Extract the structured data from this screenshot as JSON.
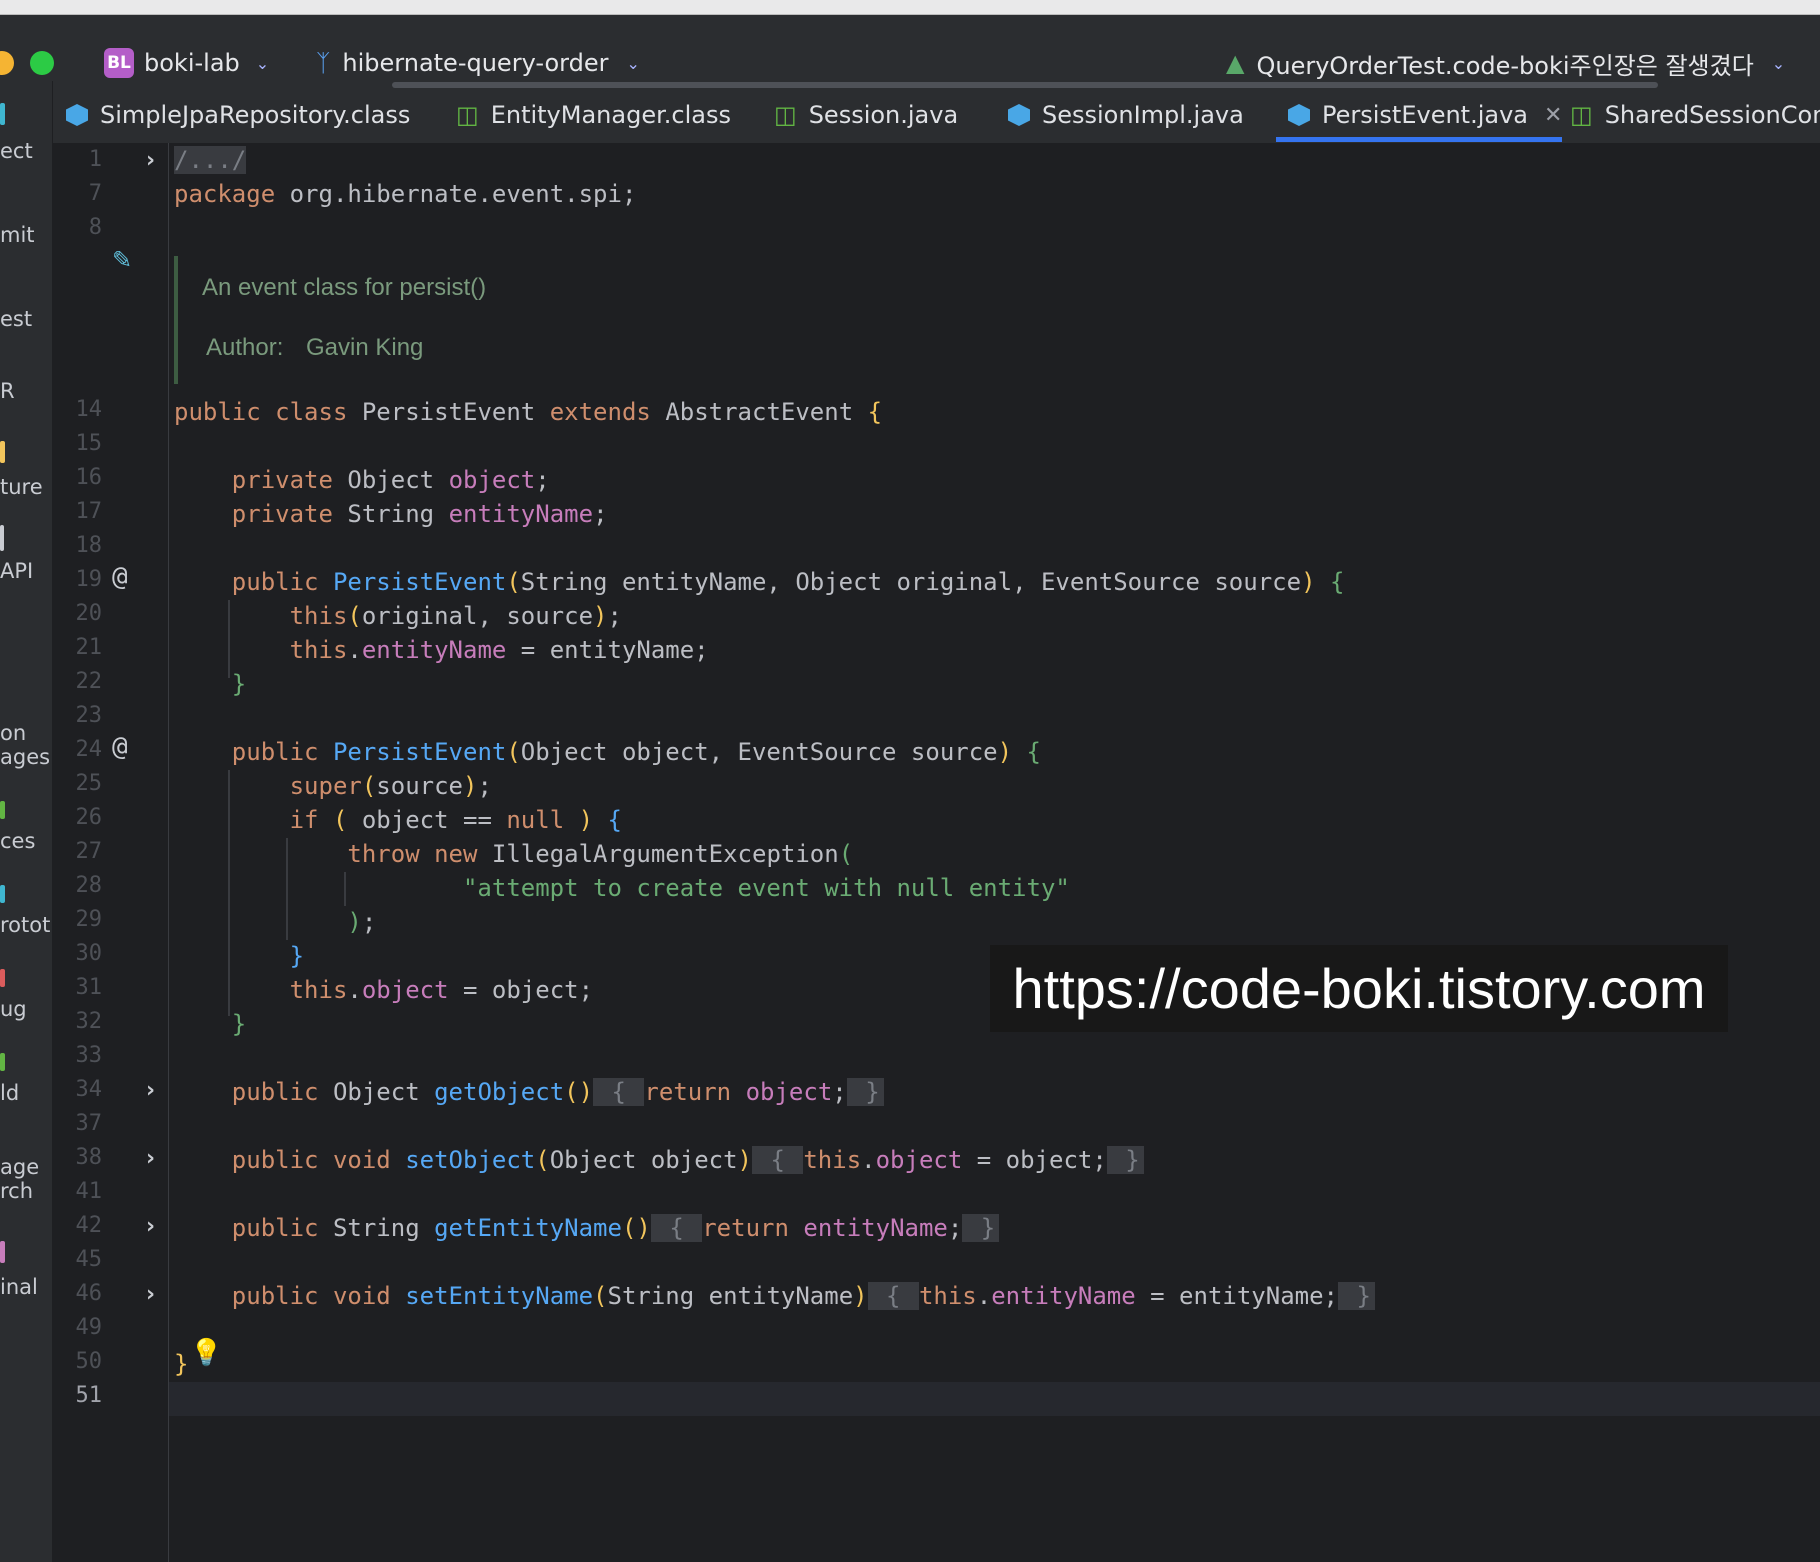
{
  "titlebar": {
    "project_badge": "BL",
    "project_name": "boki-lab",
    "branch": "hibernate-query-order",
    "run_config": "QueryOrderTest.code-boki주인장은 잘생겼다"
  },
  "tabs": [
    {
      "label": "SimpleJpaRepository.class",
      "icon": "class-icon",
      "active": false
    },
    {
      "label": "EntityManager.class",
      "icon": "interface-icon",
      "active": false
    },
    {
      "label": "Session.java",
      "icon": "interface-icon",
      "active": false
    },
    {
      "label": "SessionImpl.java",
      "icon": "class-icon",
      "active": false
    },
    {
      "label": "PersistEvent.java",
      "icon": "class-icon",
      "active": true
    },
    {
      "label": "SharedSessionCon",
      "icon": "interface-icon",
      "active": false
    }
  ],
  "tool_window_labels": [
    "ect",
    "mit",
    "est",
    "R",
    "ture",
    "API",
    "on",
    "ages",
    "ces",
    "rotot",
    "ug",
    "ld",
    "age",
    "rch",
    "inal"
  ],
  "line_numbers": [
    "1",
    "7",
    "8",
    "14",
    "15",
    "16",
    "17",
    "18",
    "19",
    "20",
    "21",
    "22",
    "23",
    "24",
    "25",
    "26",
    "27",
    "28",
    "29",
    "30",
    "31",
    "32",
    "33",
    "34",
    "37",
    "38",
    "41",
    "42",
    "45",
    "46",
    "49",
    "50",
    "51"
  ],
  "code": {
    "line1_collapsed": "/.../",
    "line7_kw": "package",
    "line7_rest": " org.hibernate.event.spi;",
    "doc_line1": "An event class for persist()",
    "doc_author_label": "Author:",
    "doc_author_value": "Gavin King",
    "l14": {
      "kw1": "public",
      "kw2": "class",
      "name": "PersistEvent",
      "kw3": "extends",
      "sup": "AbstractEvent",
      "brace": "{"
    },
    "l16": {
      "kw": "private",
      "type": "Object",
      "field": "object",
      "end": ";"
    },
    "l17": {
      "kw": "private",
      "type": "String",
      "field": "entityName",
      "end": ";"
    },
    "l19": {
      "kw": "public",
      "name": "PersistEvent",
      "open": "(",
      "params": "String entityName, Object original, EventSource source",
      "close": ")",
      "brace": "{"
    },
    "l20": {
      "kw": "this",
      "open": "(",
      "args": "original, source",
      "close": ")",
      "end": ";"
    },
    "l21": {
      "kw": "this",
      "dot": ".",
      "field": "entityName",
      "rest": " = entityName;"
    },
    "l22": "}",
    "l24": {
      "kw": "public",
      "name": "PersistEvent",
      "open": "(",
      "params": "Object object, EventSource source",
      "close": ")",
      "brace": "{"
    },
    "l25": {
      "kw": "super",
      "open": "(",
      "args": "source",
      "close": ")",
      "end": ";"
    },
    "l26": {
      "kw": "if",
      "open": "(",
      "cond1": " object == ",
      "null": "null",
      "close": ")",
      "brace": "{"
    },
    "l27": {
      "kw1": "throw",
      "kw2": "new",
      "cls": "IllegalArgumentException",
      "open": "("
    },
    "l28": "\"attempt to create event with null entity\"",
    "l29": {
      "close": ")",
      "end": ";"
    },
    "l30": "}",
    "l31": {
      "kw": "this",
      "dot": ".",
      "field": "object",
      "rest": " = object;"
    },
    "l32": "}",
    "l34": {
      "kw": "public",
      "type": "Object",
      "name": "getObject",
      "parens": "()",
      "ob": "{",
      "kw2": "return",
      "field": "object",
      "end": ";",
      "cb": "}"
    },
    "l38": {
      "kw1": "public",
      "kw2": "void",
      "name": "setObject",
      "open": "(",
      "params": "Object object",
      "close": ")",
      "ob": "{",
      "kw3": "this",
      "dot": ".",
      "field": "object",
      "rest": " = object;",
      "cb": "}"
    },
    "l42": {
      "kw": "public",
      "type": "String",
      "name": "getEntityName",
      "parens": "()",
      "ob": "{",
      "kw2": "return",
      "field": "entityName",
      "end": ";",
      "cb": "}"
    },
    "l46": {
      "kw1": "public",
      "kw2": "void",
      "name": "setEntityName",
      "open": "(",
      "params": "String entityName",
      "close": ")",
      "ob": "{",
      "kw3": "this",
      "dot": ".",
      "field": "entityName",
      "rest": " = entityName;",
      "cb": "}"
    },
    "l50": "}"
  },
  "watermark": "https://code-boki.tistory.com",
  "colors": {
    "keyword": "#cf8e6d",
    "field": "#c77dbb",
    "method": "#56a8f5",
    "string": "#6aab73",
    "accent": "#3574f0"
  }
}
